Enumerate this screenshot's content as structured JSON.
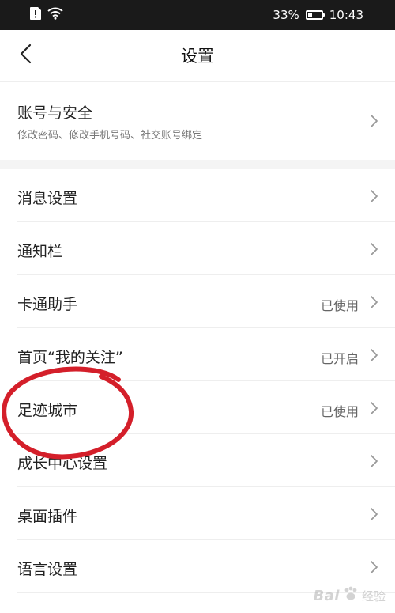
{
  "status_bar": {
    "battery_percent": "33%",
    "battery_level": 0.33,
    "time": "10:43",
    "icons": [
      "sim-alert-icon",
      "wifi-icon",
      "battery-icon"
    ]
  },
  "header": {
    "title": "设置",
    "back_icon": "chevron-left-icon"
  },
  "account": {
    "title": "账号与安全",
    "subtitle": "修改密码、修改手机号码、社交账号绑定"
  },
  "items": [
    {
      "label": "消息设置",
      "status": ""
    },
    {
      "label": "通知栏",
      "status": ""
    },
    {
      "label": "卡通助手",
      "status": "已使用"
    },
    {
      "label": "首页“我的关注”",
      "status": "已开启"
    },
    {
      "label": "足迹城市",
      "status": "已使用"
    },
    {
      "label": "成长中心设置",
      "status": ""
    },
    {
      "label": "桌面插件",
      "status": ""
    },
    {
      "label": "语言设置",
      "status": ""
    }
  ],
  "annotation": {
    "shape": "red-ellipse-circling-row-5",
    "color": "#d41f2a"
  },
  "watermark": {
    "logo": "Bai",
    "suffix": "经验"
  },
  "colors": {
    "status_bar_bg": "#1a1a1a",
    "section_gap": "#f4f4f4",
    "annotation": "#d41f2a"
  }
}
